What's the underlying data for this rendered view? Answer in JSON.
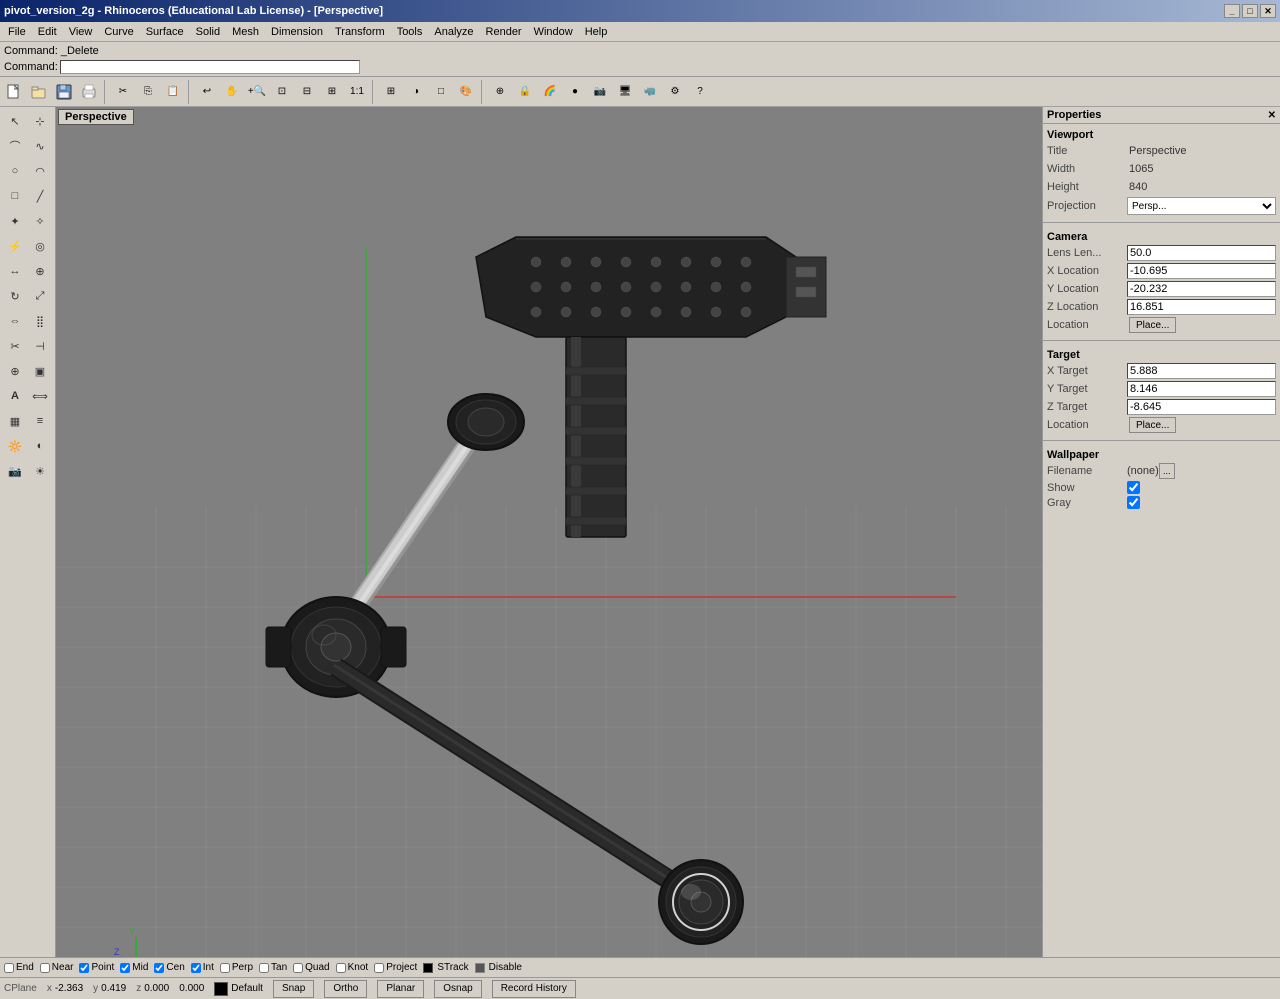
{
  "titlebar": {
    "title": "pivot_version_2g - Rhinoceros (Educational Lab License) - [Perspective]",
    "controls": [
      "_",
      "□",
      "✕"
    ]
  },
  "menubar": {
    "items": [
      "File",
      "Edit",
      "View",
      "Curve",
      "Surface",
      "Solid",
      "Mesh",
      "Dimension",
      "Transform",
      "Tools",
      "Analyze",
      "Render",
      "Window",
      "Help"
    ]
  },
  "commandarea": {
    "line1": "Command: _Delete",
    "line2_label": "Command:",
    "placeholder": ""
  },
  "viewport": {
    "label": "Perspective"
  },
  "properties": {
    "title": "Properties",
    "sections": {
      "viewport_title": "Viewport",
      "title_label": "Title",
      "title_value": "Perspective",
      "width_label": "Width",
      "width_value": "1065",
      "height_label": "Height",
      "height_value": "840",
      "projection_label": "Projection",
      "projection_value": "Persp...",
      "camera_title": "Camera",
      "lens_label": "Lens Len...",
      "lens_value": "50.0",
      "x_location_label": "X Location",
      "x_location_value": "-10.695",
      "y_location_label": "Y Location",
      "y_location_value": "-20.232",
      "z_location_label": "Z Location",
      "z_location_value": "16.851",
      "location_label": "Location",
      "location_btn": "Place...",
      "target_title": "Target",
      "x_target_label": "X Target",
      "x_target_value": "5.888",
      "y_target_label": "Y Target",
      "y_target_value": "8.146",
      "z_target_label": "Z Target",
      "z_target_value": "-8.645",
      "target_location_label": "Location",
      "target_location_btn": "Place...",
      "wallpaper_title": "Wallpaper",
      "filename_label": "Filename",
      "filename_value": "(none)",
      "show_label": "Show",
      "gray_label": "Gray"
    }
  },
  "statusbar": {
    "snap_items": [
      "End",
      "Near",
      "Point",
      "Mid",
      "Cen",
      "Int",
      "Perp",
      "Tan",
      "Quad",
      "Knot",
      "Project",
      "STrack",
      "Disable"
    ],
    "snap_checks": [
      false,
      false,
      true,
      true,
      true,
      true,
      false,
      false,
      false,
      false,
      false,
      true,
      false
    ]
  },
  "coordbar": {
    "cplane_label": "CPlane",
    "x_label": "x",
    "x_value": "-2.363",
    "y_label": "y",
    "y_value": "0.419",
    "z_label": "z",
    "z_value": "0.000",
    "delta": "0.000",
    "layer_label": "Default",
    "snap_btn": "Snap",
    "ortho_btn": "Ortho",
    "planar_btn": "Planar",
    "osnap_btn": "Osnap",
    "record_btn": "Record History"
  },
  "toolbar_icons": [
    "new",
    "open",
    "save",
    "print",
    "cut",
    "copy",
    "paste",
    "undo",
    "redo",
    "pan",
    "zoom_in",
    "zoom_ext",
    "zoom_sel",
    "zoom_wind",
    "zoom_1to1",
    "grid",
    "shade",
    "wire",
    "render_preview",
    "snap_grid",
    "lock",
    "colors",
    "material",
    "camera",
    "display_mode",
    "rhino_logo",
    "plugin"
  ],
  "left_toolbar": {
    "tools": [
      "cursor",
      "select",
      "polyline",
      "circle",
      "arc",
      "rectangle",
      "freeform",
      "edit_pts",
      "control_pts",
      "move",
      "copy_t",
      "rotate",
      "scale",
      "mirror",
      "array",
      "trim",
      "split",
      "join",
      "group",
      "text",
      "dim",
      "hatch",
      "analysis",
      "layer",
      "render_t"
    ]
  }
}
